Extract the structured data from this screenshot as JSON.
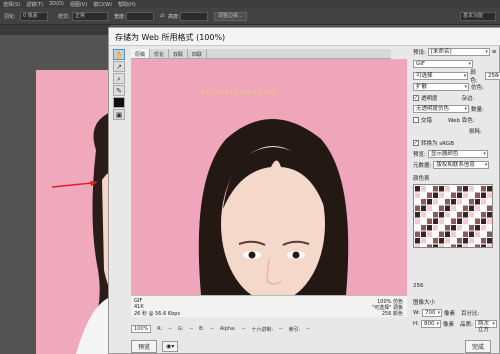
{
  "menubar": {
    "items": [
      "选择(S)",
      "滤镜(T)",
      "3D(D)",
      "视图(V)",
      "窗口(W)",
      "帮助(H)"
    ]
  },
  "options": {
    "feather_label": "羽化:",
    "feather_value": "0 像素",
    "style_label": "样式:",
    "style_value": "正常",
    "width_label": "宽度:",
    "height_label": "高度:",
    "refine_button": "调整边缘...",
    "workspace": "基本功能"
  },
  "dialog": {
    "title": "存储为 Web 所用格式 (100%)",
    "view_tabs": [
      "原稿",
      "优化",
      "双联",
      "四联"
    ],
    "active_tab": "原稿",
    "preview_text": "Ctrl+Alt+shift+s",
    "info": {
      "format": "GIF",
      "size": "41K",
      "time": "26 秒 @ 56.6 Kbps",
      "zoom_dither": "100% 仿色",
      "palette": "\"可选择\" 调板",
      "colors": "256 颜色"
    },
    "status": {
      "zoom": "100%",
      "r_label": "R:",
      "r_value": "--",
      "g_label": "G:",
      "g_value": "--",
      "b_label": "B:",
      "b_value": "--",
      "alpha_label": "Alpha:",
      "alpha_value": "--",
      "hex_label": "十六进制:",
      "hex_value": "--",
      "index_label": "索引:",
      "index_value": "--"
    },
    "preview_button": "预览",
    "done_button": "完成"
  },
  "panel": {
    "preset_label": "预设:",
    "preset_value": "[未命名]",
    "format_value": "GIF",
    "reduction_value": "可选择",
    "dither_algo_value": "扩散",
    "transparency_label": "透明度",
    "transparency_dither_value": "无透明度仿色",
    "interlaced_label": "交错",
    "colors_label": "颜色:",
    "colors_value": "256",
    "dither_label": "仿色:",
    "matte_label": "杂边:",
    "amount_label": "数量:",
    "web_snap_label": "Web 靠色:",
    "lossy_label": "损耗:",
    "convert_srgb_label": "转换为 sRGB",
    "preview_label": "预览:",
    "preview_value": "显示器颜色",
    "metadata_label": "元数据:",
    "metadata_value": "版权和联系信息",
    "color_table_label": "颜色表",
    "color_count": "256",
    "image_size_label": "图像大小",
    "w_label": "W:",
    "w_value": "700",
    "w_unit": "像素",
    "h_label": "H:",
    "h_value": "800",
    "h_unit": "像素",
    "percent_label": "百分比:",
    "percent_value": "100",
    "quality_label": "品质:",
    "quality_value": "两次立方"
  }
}
